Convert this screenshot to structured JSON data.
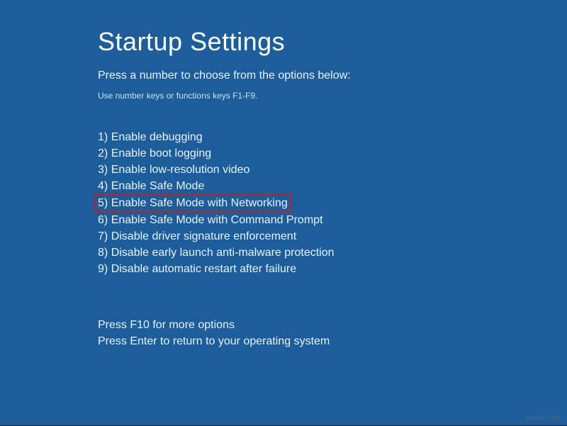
{
  "title": "Startup Settings",
  "instruction": "Press a number to choose from the options below:",
  "hint": "Use number keys or functions keys F1-F9.",
  "options": [
    {
      "num": "1)",
      "label": "Enable debugging",
      "highlighted": false
    },
    {
      "num": "2)",
      "label": "Enable boot logging",
      "highlighted": false
    },
    {
      "num": "3)",
      "label": "Enable low-resolution video",
      "highlighted": false
    },
    {
      "num": "4)",
      "label": "Enable Safe Mode",
      "highlighted": false
    },
    {
      "num": "5)",
      "label": "Enable Safe Mode with Networking",
      "highlighted": true
    },
    {
      "num": "6)",
      "label": "Enable Safe Mode with Command Prompt",
      "highlighted": false
    },
    {
      "num": "7)",
      "label": "Disable driver signature enforcement",
      "highlighted": false
    },
    {
      "num": "8)",
      "label": "Disable early launch anti-malware protection",
      "highlighted": false
    },
    {
      "num": "9)",
      "label": "Disable automatic restart after failure",
      "highlighted": false
    }
  ],
  "footer": {
    "more": "Press F10 for more options",
    "return": "Press Enter to return to your operating system"
  },
  "watermark": "wsxdn.com"
}
